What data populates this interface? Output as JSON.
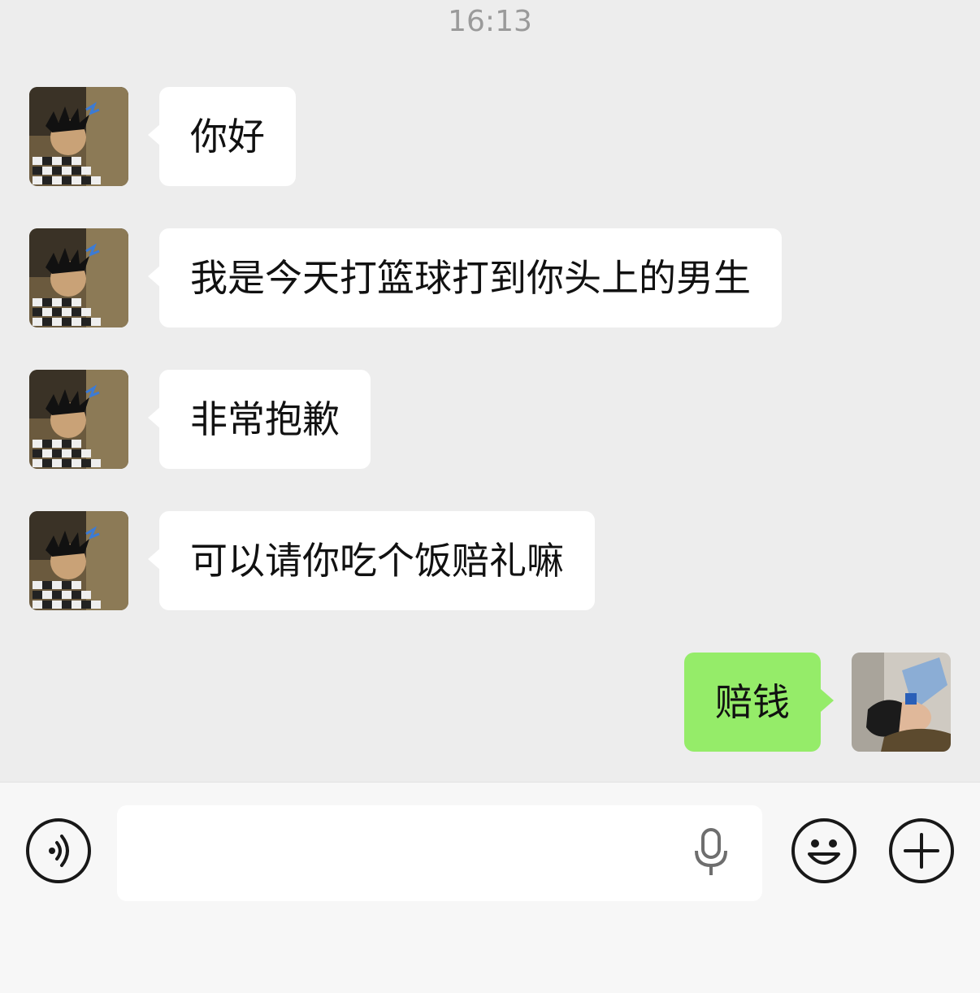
{
  "chat": {
    "timestamp": "16:13",
    "messages": [
      {
        "side": "in",
        "text": "你好"
      },
      {
        "side": "in",
        "text": "我是今天打篮球打到你头上的男生"
      },
      {
        "side": "in",
        "text": "非常抱歉"
      },
      {
        "side": "in",
        "text": "可以请你吃个饭赔礼嘛"
      },
      {
        "side": "out",
        "text": "赔钱"
      }
    ]
  },
  "input_bar": {
    "text_value": "",
    "icons": {
      "voice": "voice-mode-icon",
      "mic": "microphone-icon",
      "emoji": "emoji-icon",
      "plus": "plus-icon"
    }
  },
  "colors": {
    "background": "#ededed",
    "incoming_bubble": "#ffffff",
    "outgoing_bubble": "#95ec69",
    "timestamp": "#9a9a9a"
  }
}
